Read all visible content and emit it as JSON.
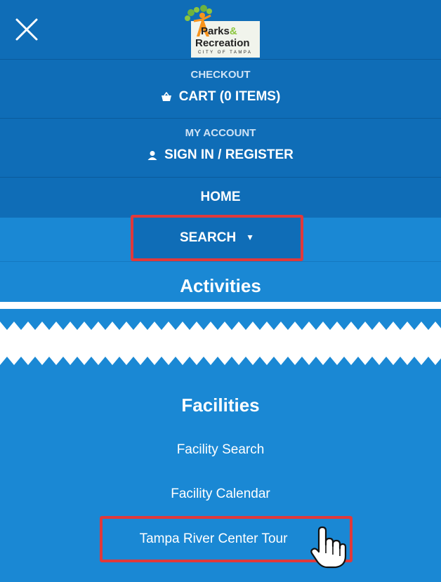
{
  "header": {
    "close_icon": "close-icon",
    "logo": {
      "line1": "Parks",
      "amp": "&",
      "line2": "Recreation",
      "line3": "CITY OF TAMPA"
    }
  },
  "checkout": {
    "caption": "CHECKOUT",
    "label": "CART (0 ITEMS)",
    "icon": "basket-icon"
  },
  "account": {
    "caption": "MY ACCOUNT",
    "label": "SIGN IN / REGISTER",
    "icon": "user-icon"
  },
  "nav": {
    "home": "HOME",
    "search": "SEARCH",
    "search_caret": "▼"
  },
  "sections": {
    "activities": "Activities",
    "facilities": "Facilities",
    "facility_links": [
      "Facility Search",
      "Facility Calendar",
      "Tampa River Center Tour"
    ]
  },
  "colors": {
    "nav_dark": "#0f6db7",
    "nav_light": "#1a88d4",
    "highlight": "#e0393b"
  }
}
